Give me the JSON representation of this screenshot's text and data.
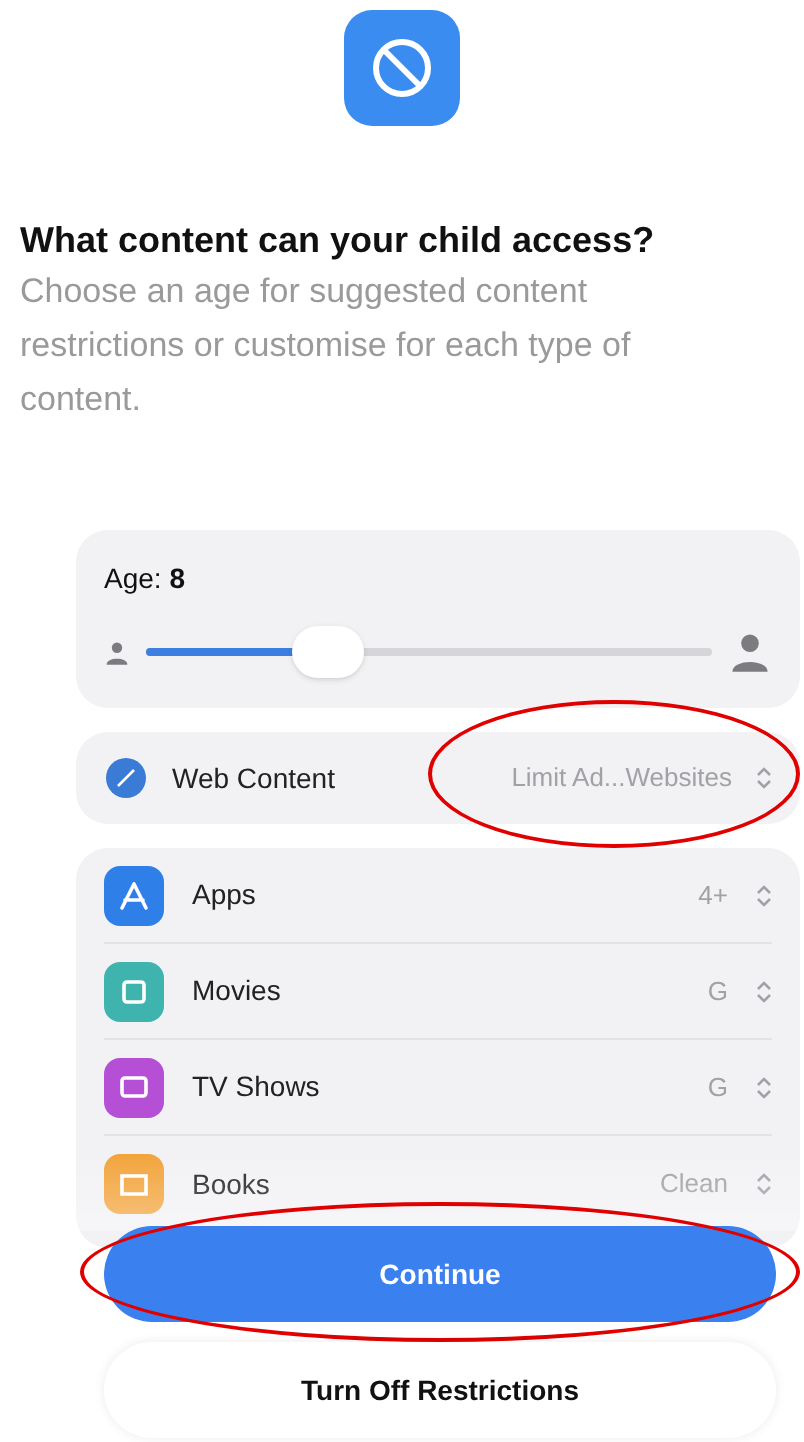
{
  "header": {
    "title": "What content can your child access?",
    "description": "Choose an age for suggested content restrictions or customise for each type of content."
  },
  "age": {
    "label": "Age:",
    "value": "8",
    "level": 0.32
  },
  "web_content": {
    "label": "Web Content",
    "value": "Limit Ad...Websites",
    "circled": true
  },
  "categories": [
    {
      "kind": "apps",
      "label": "Apps",
      "value": "4+"
    },
    {
      "kind": "movies",
      "label": "Movies",
      "value": "G"
    },
    {
      "kind": "tv",
      "label": "TV Shows",
      "value": "G"
    },
    {
      "kind": "books",
      "label": "Books",
      "value": "Clean"
    }
  ],
  "buttons": [
    {
      "kind": "primary",
      "label": "Continue",
      "circled": true
    },
    {
      "kind": "secondary",
      "label": "Turn Off Restrictions",
      "circled": false
    }
  ]
}
